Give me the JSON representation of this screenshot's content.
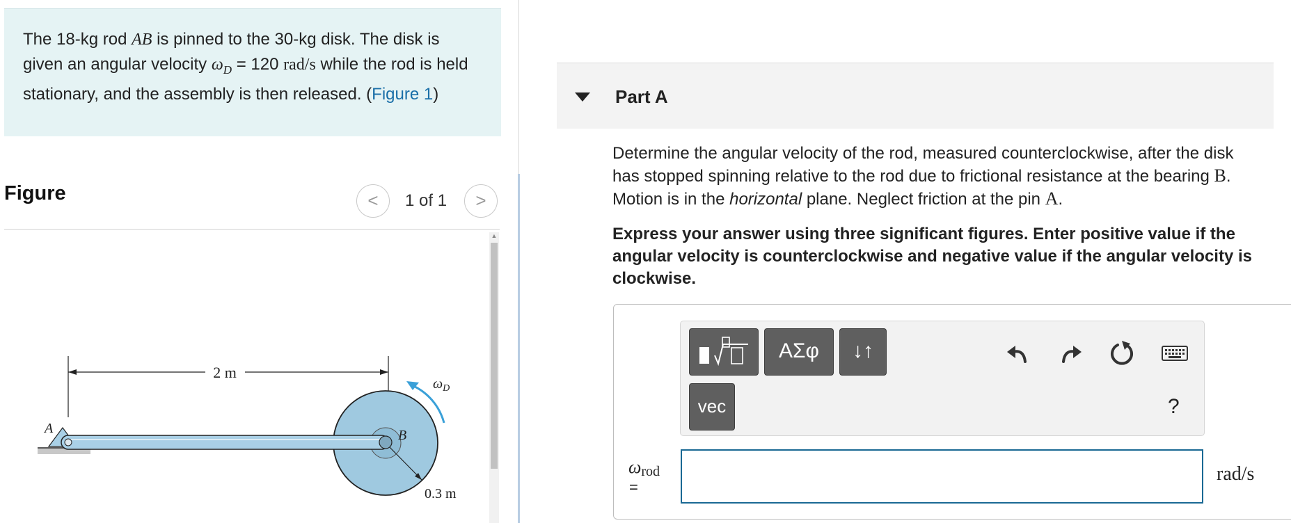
{
  "problem": {
    "text_before": "The 18-kg rod ",
    "rod_name": "AB",
    "text_mid": " is pinned to the 30-kg disk. The disk is given an angular velocity ",
    "omega_symbol": "ω",
    "omega_sub": "D",
    "text_eq": " = 120 ",
    "omega_unit": "rad/s",
    "text_after": " while the rod is held stationary, and the assembly is then released. (",
    "figure_link": "Figure 1",
    "text_close": ")"
  },
  "figure_panel": {
    "heading": "Figure",
    "pager": "1 of 1",
    "prev_icon": "chevron-left-icon",
    "next_icon": "chevron-right-icon",
    "prev_glyph": "<",
    "next_glyph": ">",
    "figure_labels": {
      "length": "2 m",
      "radius": "0.3 m",
      "point_a": "A",
      "point_b": "B",
      "omega": "ω",
      "omega_sub": "D"
    },
    "colors": {
      "disk_fill": "#9fc9e0",
      "rod_fill": "#a9d0e6",
      "outline": "#222222"
    }
  },
  "part_a": {
    "title": "Part A",
    "question_1": "Determine the angular velocity of the rod, measured counterclockwise, after the disk has stopped spinning relative to the rod due to frictional resistance at the bearing ",
    "bearing": "B",
    "question_2": ". Motion is in the ",
    "horizontal": "horizontal",
    "question_3": " plane. Neglect friction at the pin ",
    "pin": "A",
    "question_4": ".",
    "instructions": "Express your answer using three significant figures. Enter positive value if the angular velocity is counterclockwise and negative value if the angular velocity is clockwise."
  },
  "toolbar": {
    "templates_icon": "templates-icon",
    "symbols_label": "ΑΣφ",
    "order_label": "↓↑",
    "vec_label": "vec",
    "undo_icon": "undo-icon",
    "redo_icon": "redo-icon",
    "reset_icon": "reset-icon",
    "keyboard_icon": "keyboard-icon",
    "help_label": "?"
  },
  "answer": {
    "variable": "ω",
    "variable_sub": "rod",
    "equals": "=",
    "value": "",
    "unit": "rad/s"
  },
  "colors": {
    "problem_bg": "#e5f3f4",
    "link": "#1a6fa8",
    "input_border": "#1a6994",
    "button_bg": "#5f5f5f"
  }
}
